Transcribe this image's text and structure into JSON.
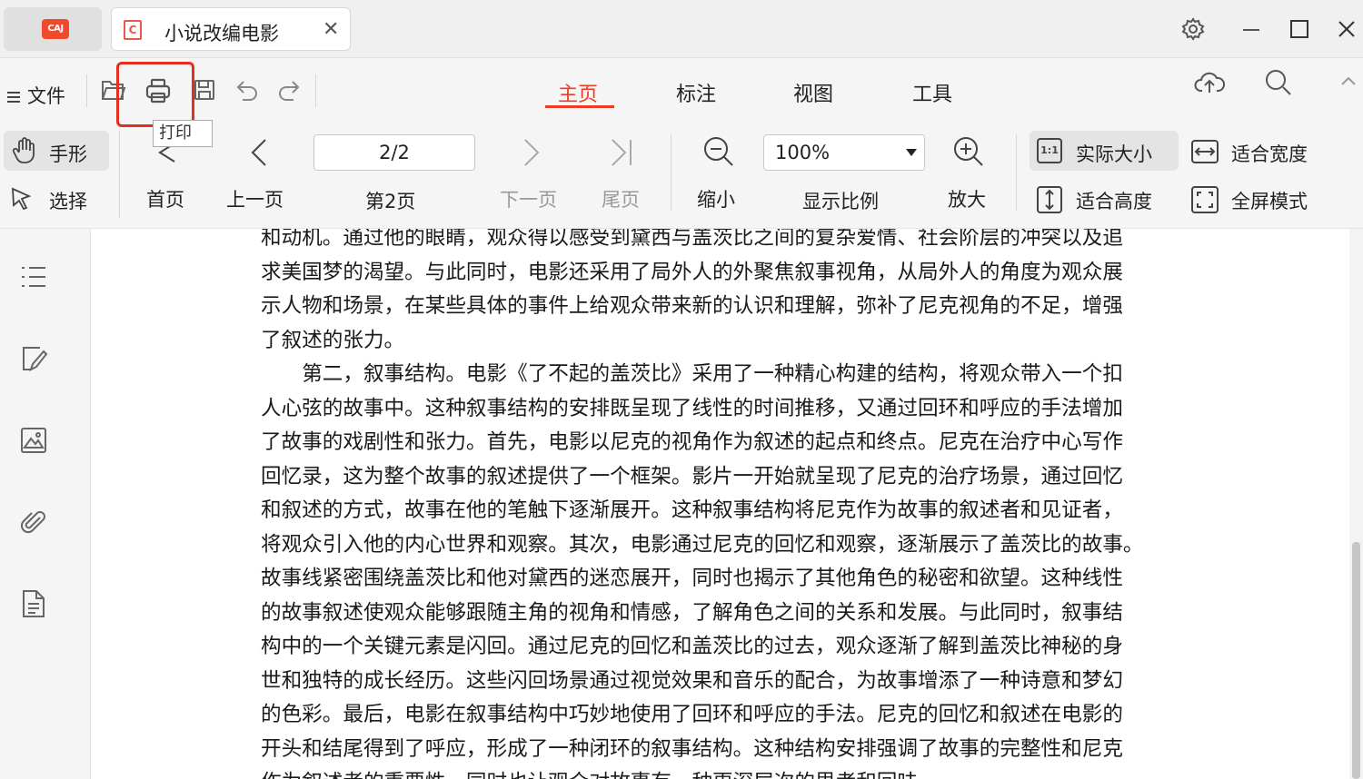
{
  "app": {
    "logo_text": "CAJ",
    "doc_tab_icon": "C",
    "doc_tab_title": "小说改编电影",
    "close_symbol": "✕"
  },
  "window_controls": [
    "settings-icon",
    "minimize-icon",
    "maximize-icon",
    "close-icon"
  ],
  "menu": {
    "file_label": "文件"
  },
  "quick_access": [
    "open-icon",
    "print-icon",
    "save-icon",
    "undo-icon",
    "redo-icon"
  ],
  "tooltip": "打印",
  "tabs": [
    {
      "label": "主页",
      "active": true
    },
    {
      "label": "标注",
      "active": false
    },
    {
      "label": "视图",
      "active": false
    },
    {
      "label": "工具",
      "active": false
    }
  ],
  "right_top_icons": [
    "cloud-upload-icon",
    "search-icon",
    "collapse-icon"
  ],
  "tools": {
    "hand": "手形",
    "select": "选择"
  },
  "navigation": {
    "first": "首页",
    "prev": "上一页",
    "page_value": "2/2",
    "page_label": "第2页",
    "next": "下一页",
    "last": "尾页"
  },
  "zoom": {
    "zoom_out": "缩小",
    "value": "100%",
    "label": "显示比例",
    "zoom_in": "放大"
  },
  "view_modes": {
    "actual_size_icon": "1:1",
    "actual_size": "实际大小",
    "fit_width": "适合宽度",
    "fit_height": "适合高度",
    "fullscreen": "全屏模式"
  },
  "sidebar_icons": [
    "outline-icon",
    "annotation-icon",
    "image-icon",
    "attachment-icon",
    "document-icon"
  ],
  "document": {
    "lines": [
      {
        "text": "和动机。通过他的眼睛，观众得以感受到黛西与盖茨比之间的复杂爱情、社会阶层的冲突以及追",
        "indent": false
      },
      {
        "text": "求美国梦的渴望。与此同时，电影还采用了局外人的外聚焦叙事视角，从局外人的角度为观众展",
        "indent": false
      },
      {
        "text": "示人物和场景，在某些具体的事件上给观众带来新的认识和理解，弥补了尼克视角的不足，增强",
        "indent": false
      },
      {
        "text": "了叙述的张力。",
        "indent": false
      },
      {
        "text": "第二，叙事结构。电影《了不起的盖茨比》采用了一种精心构建的结构，将观众带入一个扣",
        "indent": true
      },
      {
        "text": "人心弦的故事中。这种叙事结构的安排既呈现了线性的时间推移，又通过回环和呼应的手法增加",
        "indent": false
      },
      {
        "text": "了故事的戏剧性和张力。首先，电影以尼克的视角作为叙述的起点和终点。尼克在治疗中心写作",
        "indent": false
      },
      {
        "text": "回忆录，这为整个故事的叙述提供了一个框架。影片一开始就呈现了尼克的治疗场景，通过回忆",
        "indent": false
      },
      {
        "text": "和叙述的方式，故事在他的笔触下逐渐展开。这种叙事结构将尼克作为故事的叙述者和见证者，",
        "indent": false
      },
      {
        "text": "将观众引入他的内心世界和观察。其次，电影通过尼克的回忆和观察，逐渐展示了盖茨比的故事。",
        "indent": false
      },
      {
        "text": "故事线紧密围绕盖茨比和他对黛西的迷恋展开，同时也揭示了其他角色的秘密和欲望。这种线性",
        "indent": false
      },
      {
        "text": "的故事叙述使观众能够跟随主角的视角和情感，了解角色之间的关系和发展。与此同时，叙事结",
        "indent": false
      },
      {
        "text": "构中的一个关键元素是闪回。通过尼克的回忆和盖茨比的过去，观众逐渐了解到盖茨比神秘的身",
        "indent": false
      },
      {
        "text": "世和独特的成长经历。这些闪回场景通过视觉效果和音乐的配合，为故事增添了一种诗意和梦幻",
        "indent": false
      },
      {
        "text": "的色彩。最后，电影在叙事结构中巧妙地使用了回环和呼应的手法。尼克的回忆和叙述在电影的",
        "indent": false
      },
      {
        "text": "开头和结尾得到了呼应，形成了一种闭环的叙事结构。这种结构安排强调了故事的完整性和尼克",
        "indent": false
      },
      {
        "text": "作为叙述者的重要性。同时也让观众对故事有一种更深层次的思考和回味。",
        "indent": false
      }
    ]
  },
  "colors": {
    "accent": "#ee3b26",
    "highlight_box": "#e62e1e",
    "logo_bg": "#ef4a2c"
  }
}
